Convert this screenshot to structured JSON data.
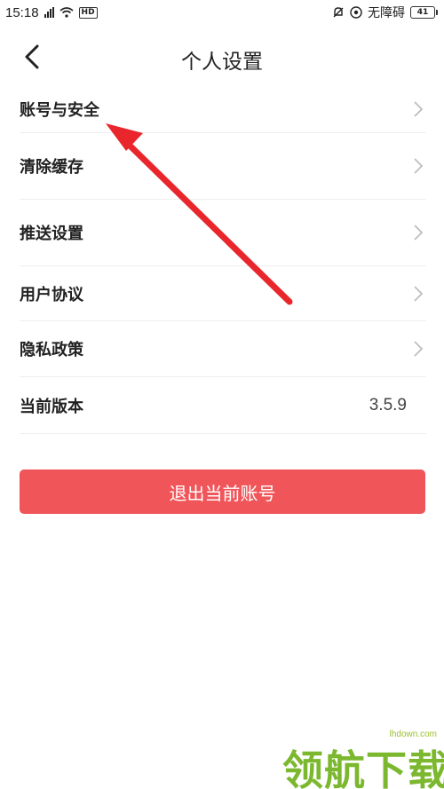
{
  "status_bar": {
    "time": "15:18",
    "network_tag": "HD",
    "accessibility": "无障碍",
    "battery": "41"
  },
  "nav": {
    "title": "个人设置"
  },
  "menu": [
    {
      "label": "账号与安全",
      "has_chevron": true
    },
    {
      "label": "清除缓存",
      "has_chevron": true
    },
    {
      "label": "推送设置",
      "has_chevron": true
    },
    {
      "label": "用户协议",
      "has_chevron": true
    },
    {
      "label": "隐私政策",
      "has_chevron": true
    },
    {
      "label": "当前版本",
      "value": "3.5.9"
    }
  ],
  "logout_button": "退出当前账号",
  "watermark": {
    "url": "lhdown.com",
    "text": "领航下载"
  },
  "colors": {
    "accent": "#f05559",
    "annotation_arrow": "#e8262c",
    "watermark": "#7cb82f"
  }
}
